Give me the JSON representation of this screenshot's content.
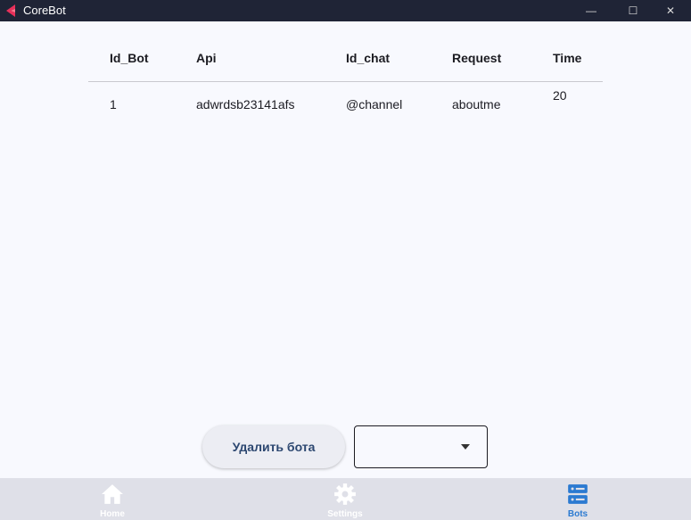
{
  "window": {
    "title": "CoreBot",
    "controls": {
      "minimize": "—",
      "maximize": "☐",
      "close": "✕"
    }
  },
  "table": {
    "columns": [
      "Id_Bot",
      "Api",
      "Id_chat",
      "Request",
      "Time"
    ],
    "rows": [
      [
        "1",
        "adwrdsb23141afs",
        "@channel",
        "aboutme",
        "20"
      ]
    ]
  },
  "actions": {
    "delete_label": "Удалить бота",
    "select_value": ""
  },
  "nav": {
    "items": [
      {
        "label": "Home",
        "icon": "home-icon",
        "active": false
      },
      {
        "label": "Settings",
        "icon": "gear-icon",
        "active": false
      },
      {
        "label": "Bots",
        "icon": "server-icon",
        "active": true
      }
    ]
  },
  "colors": {
    "titlebar": "#1f2436",
    "background": "#f8f9fe",
    "nav_background": "#dfe0e8",
    "nav_active": "#2b7ad1",
    "nav_inactive": "#ffffff",
    "button_text": "#2c4770",
    "logo": "#e8305a"
  }
}
